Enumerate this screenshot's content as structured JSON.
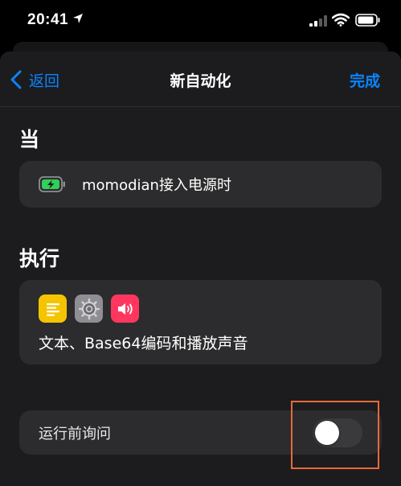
{
  "status_bar": {
    "time": "20:41",
    "icons": [
      "location-arrow-icon",
      "cellular-signal-icon",
      "wifi-icon",
      "battery-icon"
    ]
  },
  "navbar": {
    "back_label": "返回",
    "title": "新自动化",
    "done_label": "完成"
  },
  "when_section": {
    "heading": "当",
    "trigger": {
      "icon": "battery-charging-icon",
      "text": "momodian接入电源时"
    }
  },
  "do_section": {
    "heading": "执行",
    "action": {
      "icons": [
        "text-app-icon",
        "settings-gear-icon",
        "speaker-sound-icon"
      ],
      "text": "文本、Base64编码和播放声音"
    }
  },
  "ask_before_running": {
    "label": "运行前询问",
    "enabled": false
  },
  "colors": {
    "accent": "#0a84ff",
    "background": "#1c1c1e",
    "card": "#2c2c2e",
    "highlight": "#e8693a"
  }
}
